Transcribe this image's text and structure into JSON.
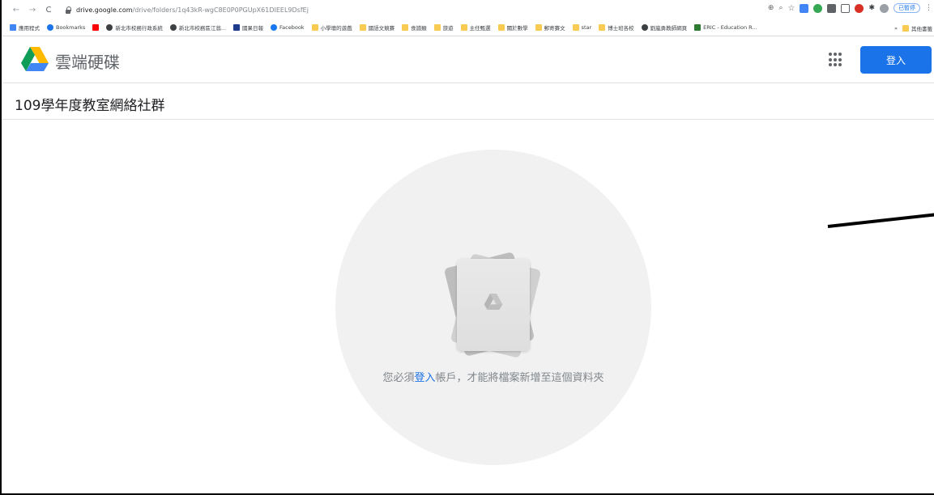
{
  "browser": {
    "url_host": "drive.google.com",
    "url_path": "/drive/folders/1q43kR-wgC8E0P0PGUpX61DIEEL9DsfEj",
    "profile_status": "已暫停"
  },
  "bookmarks": [
    {
      "label": "應用程式",
      "icon": "apps-icon",
      "color": "#4285f4"
    },
    {
      "label": "Bookmarks",
      "icon": "star-icon",
      "color": "#1a73e8"
    },
    {
      "label": "",
      "icon": "youtube-icon",
      "color": "#ff0000"
    },
    {
      "label": "新北市校務行政系統",
      "icon": "globe-icon",
      "color": "#3c4043"
    },
    {
      "label": "新北市校務區江翁...",
      "icon": "globe-icon",
      "color": "#3c4043"
    },
    {
      "label": "國果日報",
      "icon": "newspaper-icon",
      "color": "#1e3a8a"
    },
    {
      "label": "Facebook",
      "icon": "facebook-icon",
      "color": "#1877f2"
    },
    {
      "label": "小學壇的遊戲",
      "icon": "folder-icon",
      "color": "#f9cb52"
    },
    {
      "label": "國語文競賽",
      "icon": "folder-icon",
      "color": "#f9cb52"
    },
    {
      "label": "食譜類",
      "icon": "folder-icon",
      "color": "#f9cb52"
    },
    {
      "label": "旅遊",
      "icon": "folder-icon",
      "color": "#f9cb52"
    },
    {
      "label": "主任甄選",
      "icon": "folder-icon",
      "color": "#f9cb52"
    },
    {
      "label": "關於數學",
      "icon": "folder-icon",
      "color": "#f9cb52"
    },
    {
      "label": "郵寄賽文",
      "icon": "folder-icon",
      "color": "#f9cb52"
    },
    {
      "label": "star",
      "icon": "folder-icon",
      "color": "#f9cb52"
    },
    {
      "label": "博士班各校",
      "icon": "folder-icon",
      "color": "#f9cb52"
    },
    {
      "label": "劉嵐勇教師網頁",
      "icon": "globe-icon",
      "color": "#3c4043"
    },
    {
      "label": "ERIC - Education R...",
      "icon": "eric-icon",
      "color": "#2e7d32"
    }
  ],
  "bookmarks_more": "»",
  "bookmarks_other": "其他書籤",
  "drive": {
    "brand": "雲端硬碟",
    "signin_label": "登入",
    "folder_title": "109學年度教室網絡社群",
    "empty_prefix": "您必須",
    "empty_link": "登入",
    "empty_suffix": "帳戶，才能將檔案新增至這個資料夾"
  },
  "colors": {
    "accent": "#1a73e8",
    "empty_circle": "#f1f1f1"
  }
}
